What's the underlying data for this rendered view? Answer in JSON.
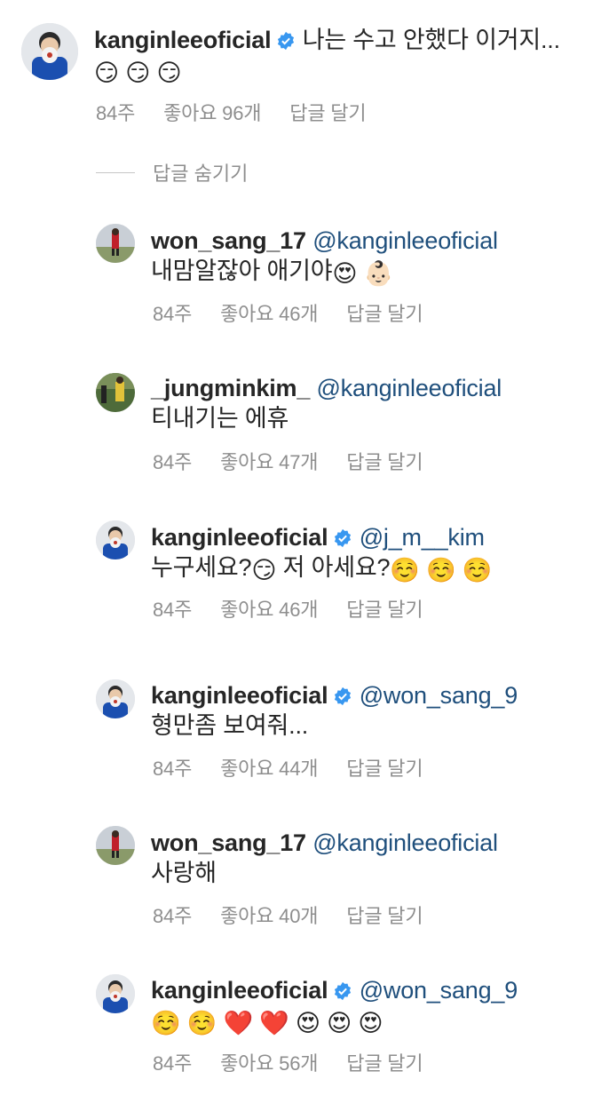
{
  "main_comment": {
    "username": "kanginleeoficial",
    "text": "나는 수고 안했다 이거지...",
    "emojis": "😏 😏 😏",
    "time": "84주",
    "likes": "좋아요 96개",
    "reply": "답글 달기"
  },
  "hide_replies_label": "답글 숨기기",
  "replies": [
    {
      "username": "won_sang_17",
      "mention": "@kanginleeoficial",
      "text": " 내맘알잖아 애기야",
      "emojis": "😍 👶🏻",
      "time": "84주",
      "likes": "좋아요 46개",
      "reply": "답글 달기"
    },
    {
      "username": "_jungminkim_",
      "mention": "@kanginleeoficial",
      "text": " 티내기는 에휴",
      "emojis": "",
      "time": "84주",
      "likes": "좋아요 47개",
      "reply": "답글 달기"
    },
    {
      "username": "kanginleeoficial",
      "mention": "@j_m__kim",
      "text": " 누구세요?",
      "text2": " 저 아세요?",
      "emoji_mid": "😏",
      "emojis": "☺️ ☺️ ☺️",
      "time": "84주",
      "likes": "좋아요 46개",
      "reply": "답글 달기"
    },
    {
      "username": "kanginleeoficial",
      "mention": "@won_sang_9",
      "text": " 형만좀 보여줘...",
      "emojis": "",
      "time": "84주",
      "likes": "좋아요 44개",
      "reply": "답글 달기"
    },
    {
      "username": "won_sang_17",
      "mention": "@kanginleeoficial",
      "text": " 사랑해",
      "emojis": "",
      "time": "84주",
      "likes": "좋아요 40개",
      "reply": "답글 달기"
    },
    {
      "username": "kanginleeoficial",
      "mention": "@won_sang_9",
      "text": "",
      "emojis": "☺️ ☺️ ❤️ ❤️ 😍 😍 😍",
      "time": "84주",
      "likes": "좋아요 56개",
      "reply": "답글 달기"
    }
  ],
  "colors": {
    "mention": "#1f4f7c",
    "meta": "#8e8e8e",
    "verified": "#3897f0"
  }
}
